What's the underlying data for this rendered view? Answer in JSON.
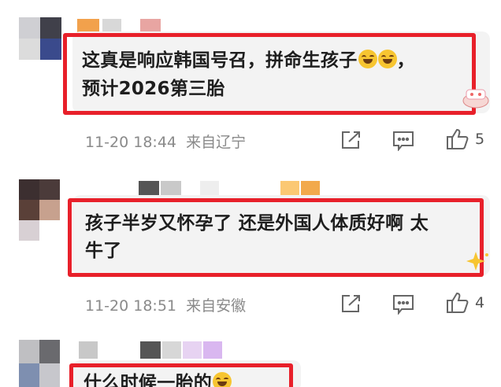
{
  "comments": [
    {
      "line1": "这真是响应韩国号召，拼命生孩子",
      "line1_tail": "，",
      "line2": "预计2026第三胎",
      "time": "11-20 18:44",
      "location": "来自辽宁",
      "likes": "5"
    },
    {
      "line1": "孩子半岁又怀孕了 还是外国人体质好啊 太",
      "line2": "牛了",
      "time": "11-20 18:51",
      "location": "来自安徽",
      "likes": "4"
    },
    {
      "line1": "什么时候一胎的"
    }
  ],
  "icons": {
    "share": "share-icon",
    "comment": "comment-icon",
    "like": "thumbs-up-icon"
  },
  "colors": {
    "highlight_border": "#e8202a",
    "bubble_bg": "#f3f3f3",
    "meta_text": "#8a8a8a"
  }
}
